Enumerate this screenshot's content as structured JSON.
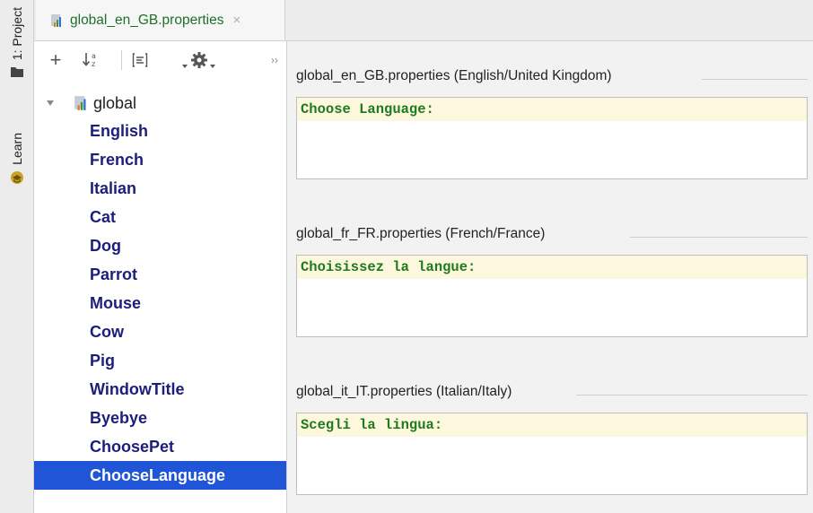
{
  "tool_window_strip": {
    "project_tab": "1: Project",
    "learn_tab": "Learn"
  },
  "editor_tab": {
    "label": "global_en_GB.properties",
    "close_glyph": "×"
  },
  "structure_toolbar": {
    "add_glyph": "+",
    "more_glyph": "››"
  },
  "tree": {
    "root_label": "global",
    "items": [
      "English",
      "French",
      "Italian",
      "Cat",
      "Dog",
      "Parrot",
      "Mouse",
      "Cow",
      "Pig",
      "WindowTitle",
      "Byebye",
      "ChoosePet",
      "ChooseLanguage"
    ],
    "selected": "ChooseLanguage"
  },
  "sections": [
    {
      "title": "global_en_GB.properties (English/United Kingdom)",
      "value": "Choose Language:"
    },
    {
      "title": "global_fr_FR.properties (French/France)",
      "value": "Choisissez la langue:"
    },
    {
      "title": "global_it_IT.properties (Italian/Italy)",
      "value": "Scegli la lingua:"
    }
  ],
  "icons": {
    "project": "folder-icon",
    "learn": "graduation-icon",
    "bundle": "resource-bundle-icon",
    "sort": "sort-alpha-icon",
    "group": "group-icon",
    "settings": "gear-icon",
    "expand": "triangle-down-icon"
  },
  "colors": {
    "selection": "#1f55d6",
    "tree_text": "#1c1e7c",
    "value_text": "#1e7a1e",
    "value_bg": "#fdf8dd",
    "tab_text": "#1f6f2a"
  }
}
